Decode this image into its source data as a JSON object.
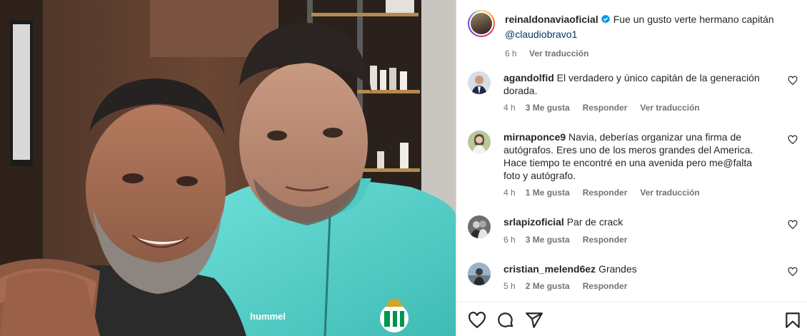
{
  "caption": {
    "username": "reinaldonaviaoficial",
    "text": "Fue un gusto verte hermano capitán",
    "mention": "@claudiobravo1",
    "time": "6 h",
    "translate": "Ver traducción"
  },
  "comments": [
    {
      "username": "agandolfid",
      "text": "El verdadero y único capitán de la generación dorada.",
      "time": "4 h",
      "likes": "3 Me gusta",
      "reply": "Responder",
      "translate": "Ver traducción"
    },
    {
      "username": "mirnaponce9",
      "text": "Navia, deberías organizar una firma de autógrafos. Eres uno de los meros grandes del America. Hace tiempo te encontré en una avenida pero me@falta foto y autógrafo.",
      "time": "4 h",
      "likes": "1 Me gusta",
      "reply": "Responder",
      "translate": "Ver traducción"
    },
    {
      "username": "srlapizoficial",
      "text": "Par de crack",
      "time": "6 h",
      "likes": "3 Me gusta",
      "reply": "Responder"
    },
    {
      "username": "cristian_melend6ez",
      "text": "Grandes",
      "time": "5 h",
      "likes": "2 Me gusta",
      "reply": "Responder"
    }
  ],
  "photo": {
    "jacket_brand": "hummel"
  },
  "icons": {
    "like": "heart-icon",
    "comment": "comment-icon",
    "share": "share-icon",
    "save": "bookmark-icon",
    "comment_like": "heart-icon",
    "verified": "verified-badge-icon"
  },
  "colors": {
    "link": "#00376b",
    "verified": "#0095f6",
    "muted": "#737373",
    "jacket": "#57d6cf"
  }
}
